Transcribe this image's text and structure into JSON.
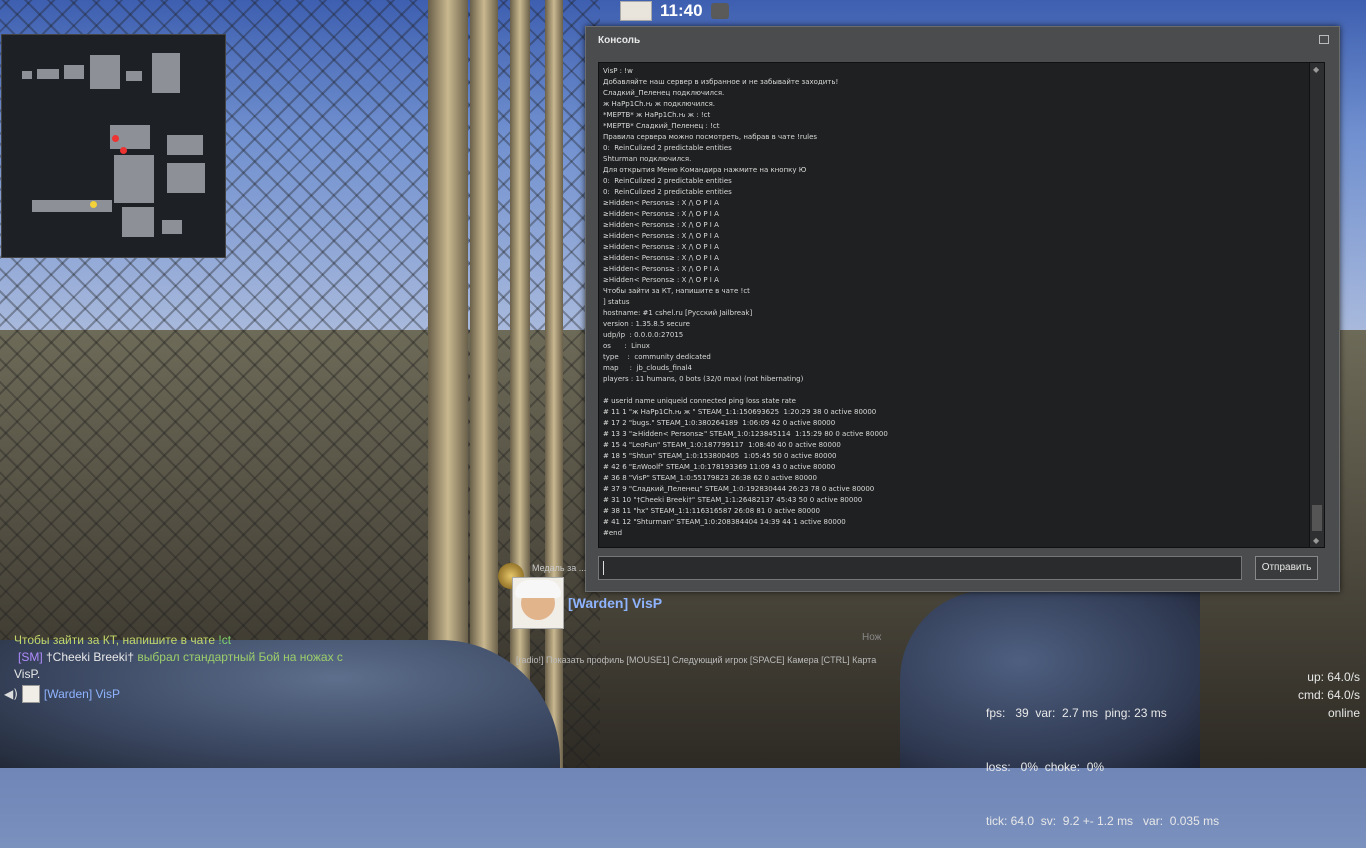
{
  "top": {
    "time": "11:40"
  },
  "console": {
    "title": "Консоль",
    "send_label": "Отправить",
    "input_value": "",
    "lines": [
      "VisP : !w",
      "Добавляйте наш сервер в избранное и не забывайте заходить!",
      "Сладкий_Пеленец подключился.",
      "ж HaPp1Ch.ԋ ж подключился.",
      "*МЕРТВ* ж HaPp1Ch.ԋ ж : !ct",
      "*МЕРТВ* Сладкий_Пеленец : !ct",
      "Правила сервера можно посмотреть, набрав в чате !rules",
      "0:  ReinCulized 2 predictable entities",
      "Shturman подключился.",
      "Для открытия Меню Командира нажмите на кнопку Ю",
      "0:  ReinCulized 2 predictable entities",
      "0:  ReinCulized 2 predictable entities",
      "≥Hidden< Persons≥ : X /\\ O P I A",
      "≥Hidden< Persons≥ : X /\\ O P I A",
      "≥Hidden< Persons≥ : X /\\ O P I A",
      "≥Hidden< Persons≥ : X /\\ O P I A",
      "≥Hidden< Persons≥ : X /\\ O P I A",
      "≥Hidden< Persons≥ : X /\\ O P I A",
      "≥Hidden< Persons≥ : X /\\ O P I A",
      "≥Hidden< Persons≥ : X /\\ O P I A",
      "Чтобы зайти за КТ, напишите в чате !ct",
      "] status",
      "hostname: #1 cshel.ru [Русский Jailbreak]",
      "version : 1.35.8.5 secure",
      "udp/ip  : 0.0.0.0:27015",
      "os      :  Linux",
      "type    :  community dedicated",
      "map     :  jb_clouds_final4",
      "players : 11 humans, 0 bots (32/0 max) (not hibernating)",
      "",
      "# userid name uniqueid connected ping loss state rate",
      "# 11 1 \"ж HaPp1Ch.ԋ ж \" STEAM_1:1:150693625  1:20:29 38 0 active 80000",
      "# 17 2 \"bugs.\" STEAM_1:0:380264189  1:06:09 42 0 active 80000",
      "# 13 3 \"≥Hidden< Persons≥\" STEAM_1:0:123845114  1:15:29 80 0 active 80000",
      "# 15 4 \"LeoFun\" STEAM_1:0:187799117  1:08:40 40 0 active 80000",
      "# 18 5 \"Shtun\" STEAM_1:0:153800405  1:05:45 50 0 active 80000",
      "# 42 6 \"ЕлWoolf\" STEAM_1:0:178193369 11:09 43 0 active 80000",
      "# 36 8 \"VisP\" STEAM_1:0:55179823 26:38 62 0 active 80000",
      "# 37 9 \"Сладкий_Пеленец\" STEAM_1:0:192830444 26:23 78 0 active 80000",
      "# 31 10 \"†Cheeki Breeki†\" STEAM_1:1:26482137 45:43 50 0 active 80000",
      "# 38 11 \"hx\" STEAM_1:1:116316587 26:08 81 0 active 80000",
      "# 41 12 \"Shturman\" STEAM_1:0:208384404 14:39 44 1 active 80000",
      "#end"
    ]
  },
  "mvp": {
    "medal_label": "Медаль за ...",
    "name": "[Warden] VisP"
  },
  "hud": {
    "weapon_label": "Нож",
    "spectator_hint": "[radio!] Показать профиль [MOUSE1] Следующий игрок [SPACE] Камера [CTRL] Карта"
  },
  "chat": {
    "line1_text": "Чтобы зайти за КТ, напишите в чате ",
    "line1_cmd": "!ct",
    "line2_tag": "[SM]",
    "line2_player": " †Cheeki Breeki† ",
    "line2_text": "выбрал стандартный Бой на ножах с",
    "line3": "VisP.",
    "voice_name": "[Warden] VisP"
  },
  "netgraph": {
    "line1": "fps:   39  var:  2.7 ms  ping: 23 ms",
    "line2": "loss:   0%  choke:  0%",
    "line3": "tick: 64.0  sv:  9.2 +- 1.2 ms   var:  0.035 ms",
    "up": "up: 64.0/s",
    "cmd": "cmd: 64.0/s",
    "status": "online"
  }
}
